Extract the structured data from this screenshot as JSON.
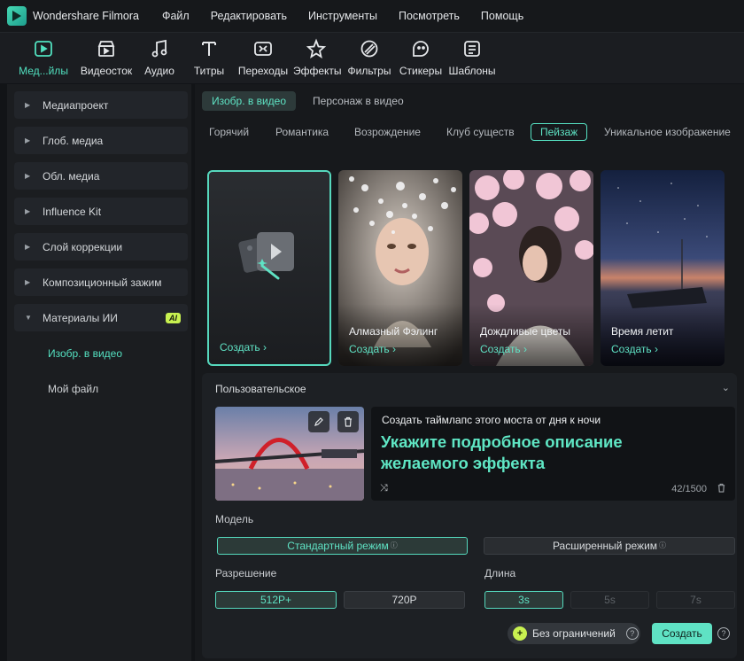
{
  "app": {
    "title": "Wondershare Filmora"
  },
  "menu": [
    "Файл",
    "Редактировать",
    "Инструменты",
    "Посмотреть",
    "Помощь"
  ],
  "toolbar": [
    {
      "label": "Мед...йлы",
      "icon": "media-icon",
      "active": true
    },
    {
      "label": "Видеосток",
      "icon": "stock-video-icon"
    },
    {
      "label": "Аудио",
      "icon": "audio-icon"
    },
    {
      "label": "Титры",
      "icon": "titles-icon"
    },
    {
      "label": "Переходы",
      "icon": "transitions-icon"
    },
    {
      "label": "Эффекты",
      "icon": "effects-icon"
    },
    {
      "label": "Фильтры",
      "icon": "filters-icon"
    },
    {
      "label": "Стикеры",
      "icon": "stickers-icon"
    },
    {
      "label": "Шаблоны",
      "icon": "templates-icon"
    }
  ],
  "sidebar": {
    "items": [
      {
        "label": "Медиапроект"
      },
      {
        "label": "Глоб. медиа"
      },
      {
        "label": "Обл. медиа"
      },
      {
        "label": "Influence Kit"
      },
      {
        "label": "Слой коррекции"
      },
      {
        "label": "Композиционный зажим"
      },
      {
        "label": "Материалы ИИ",
        "badge": "AI",
        "expanded": true
      }
    ],
    "subitems": [
      {
        "label": "Изобр. в видео",
        "active": true
      },
      {
        "label": "Мой файл"
      }
    ]
  },
  "main": {
    "subtabs": [
      {
        "label": "Изобр. в видео",
        "active": true
      },
      {
        "label": "Персонаж в видео"
      }
    ],
    "categories": [
      {
        "label": "Горячий"
      },
      {
        "label": "Романтика"
      },
      {
        "label": "Возрождение"
      },
      {
        "label": "Клуб существ"
      },
      {
        "label": "Пейзаж",
        "active": true
      },
      {
        "label": "Уникальное изображение"
      }
    ],
    "cards": [
      {
        "caption": "",
        "action": "Создать"
      },
      {
        "caption": "Алмазный Фэлинг",
        "action": "Создать"
      },
      {
        "caption": "Дождливые цветы",
        "action": "Создать"
      },
      {
        "caption": "Время летит",
        "action": "Создать"
      }
    ]
  },
  "custom": {
    "title": "Пользовательское",
    "prompt_text": "Создать таймлапс этого моста от дня к ночи",
    "prompt_hint": "Укажите подробное описание желаемого эффекта",
    "counter": "42/1500",
    "model_label": "Модель",
    "model_options": [
      {
        "label": "Стандартный режим",
        "selected": true
      },
      {
        "label": "Расширенный режим"
      }
    ],
    "resolution_label": "Разрешение",
    "resolution_options": [
      {
        "label": "512P+",
        "selected": true
      },
      {
        "label": "720P"
      }
    ],
    "length_label": "Длина",
    "length_options": [
      {
        "label": "3s",
        "selected": true
      },
      {
        "label": "5s",
        "disabled": true
      },
      {
        "label": "7s",
        "disabled": true
      }
    ],
    "unlimited_label": "Без ограничений",
    "create_label": "Создать"
  },
  "colors": {
    "accent": "#5fe2c4",
    "ai_badge": "#c8f150",
    "background": "#121417"
  }
}
